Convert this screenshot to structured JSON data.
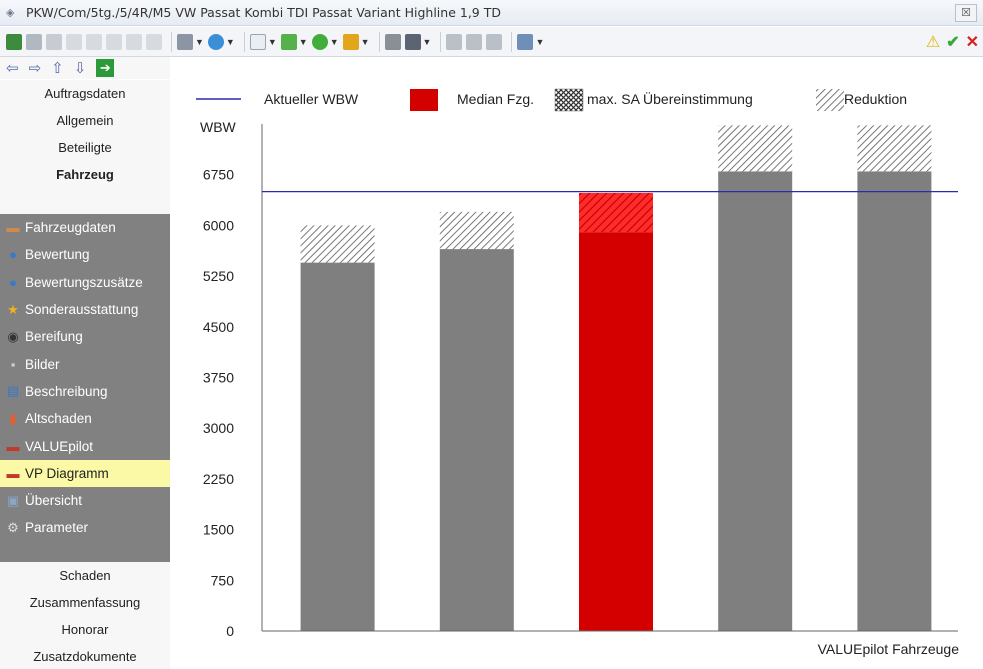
{
  "window": {
    "title": "PKW/Com/5tg./5/4R/M5 VW Passat Kombi TDI Passat Variant Highline 1,9 TD",
    "close_glyph": "☒"
  },
  "toolbar": {
    "icons": [
      "calculator-icon",
      "export-icon",
      "print-icon",
      "search-a-icon",
      "search-b-icon",
      "search-c-icon",
      "search-d-icon",
      "search-e-icon",
      "module-icon",
      "globe-icon",
      "document-icon",
      "green-doc-icon",
      "arrow-icon",
      "chart-icon",
      "camera-icon",
      "film-icon",
      "car-icon",
      "tools-icon",
      "printer-icon"
    ],
    "warning_glyph": "⚠",
    "ok_glyph": "✔",
    "cancel_glyph": "✕"
  },
  "nav": {
    "back": "⇦",
    "forward": "⇨",
    "up": "⇧",
    "down": "⇩",
    "go": "➔"
  },
  "sidebar": {
    "top_items": [
      "Auftragsdaten",
      "Allgemein",
      "Beteiligte",
      "Fahrzeug"
    ],
    "group_items": [
      {
        "label": "Fahrzeugdaten",
        "icon": "car-icon"
      },
      {
        "label": "Bewertung",
        "icon": "euro-icon"
      },
      {
        "label": "Bewertungszusätze",
        "icon": "euro-plus-icon"
      },
      {
        "label": "Sonderausstattung",
        "icon": "star-icon"
      },
      {
        "label": "Bereifung",
        "icon": "tire-icon"
      },
      {
        "label": "Bilder",
        "icon": "camera-icon"
      },
      {
        "label": "Beschreibung",
        "icon": "document-icon"
      },
      {
        "label": "Altschaden",
        "icon": "damage-icon"
      },
      {
        "label": "VALUEpilot",
        "icon": "car-red-icon"
      },
      {
        "label": "VP Diagramm",
        "icon": "car-red-icon"
      },
      {
        "label": "Übersicht",
        "icon": "overview-icon"
      },
      {
        "label": "Parameter",
        "icon": "gears-icon"
      }
    ],
    "active_item": "VP Diagramm",
    "bottom_items": [
      "Schaden",
      "Zusammenfassung",
      "Honorar",
      "Zusatzdokumente"
    ]
  },
  "chart_data": {
    "type": "bar",
    "ylabel": "WBW",
    "xlabel": "VALUEpilot Fahrzeuge",
    "ylim": [
      0,
      7500
    ],
    "yticks": [
      0,
      750,
      1500,
      2250,
      3000,
      3750,
      4500,
      5250,
      6000,
      6750
    ],
    "legend": {
      "line": "Aktueller WBW",
      "median": "Median Fzg.",
      "sa": "max. SA Übereinstimmung",
      "reduction": "Reduktion"
    },
    "reference_line": 6500,
    "bars": [
      {
        "base": 5450,
        "reduction": 550,
        "highlight": false
      },
      {
        "base": 5650,
        "reduction": 550,
        "highlight": false
      },
      {
        "base": 5900,
        "reduction": 580,
        "highlight": true
      },
      {
        "base": 6800,
        "reduction": 680,
        "highlight": false
      },
      {
        "base": 6800,
        "reduction": 680,
        "highlight": false
      }
    ],
    "colors": {
      "bar": "#7f7f7f",
      "highlight": "#d40000",
      "line": "#2b2bb0",
      "grid": "#ffffff"
    }
  }
}
